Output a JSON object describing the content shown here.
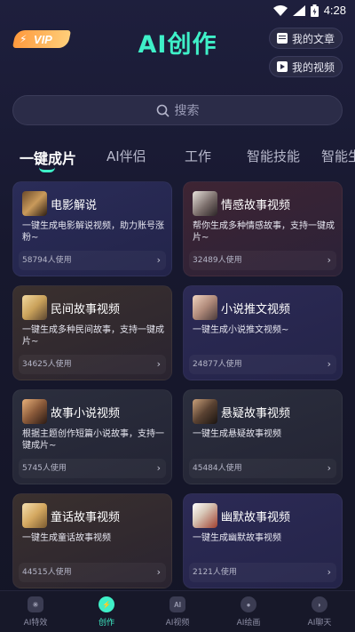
{
  "status": {
    "time": "4:28"
  },
  "header": {
    "vip_label": "VIP",
    "title": "AI创作",
    "my_articles": "我的文章",
    "my_videos": "我的视频"
  },
  "search": {
    "placeholder": "搜索"
  },
  "tabs": [
    "一键成片",
    "AI伴侣",
    "工作",
    "智能技能",
    "智能生"
  ],
  "cards": [
    {
      "title": "电影解说",
      "desc": "一键生成电影解说视频，助力账号涨粉~",
      "count": "58794人使用"
    },
    {
      "title": "情感故事视频",
      "desc": "帮你生成多种情感故事，支持一键成片~",
      "count": "32489人使用"
    },
    {
      "title": "民间故事视频",
      "desc": "一键生成多种民间故事，支持一键成片~",
      "count": "34625人使用"
    },
    {
      "title": "小说推文视频",
      "desc": "一键生成小说推文视频~",
      "count": "24877人使用"
    },
    {
      "title": "故事小说视频",
      "desc": "根据主题创作短篇小说故事，支持一键成片~",
      "count": "5745人使用"
    },
    {
      "title": "悬疑故事视频",
      "desc": "一键生成悬疑故事视频",
      "count": "45484人使用"
    },
    {
      "title": "童话故事视频",
      "desc": "一键生成童话故事视频",
      "count": "44515人使用"
    },
    {
      "title": "幽默故事视频",
      "desc": "一键生成幽默故事视频",
      "count": "2121人使用"
    }
  ],
  "nav": [
    {
      "label": "AI特效",
      "icon": "sparkle-icon"
    },
    {
      "label": "创作",
      "icon": "bolt-icon"
    },
    {
      "label": "AI视频",
      "icon": "ai-video-icon",
      "glyph": "AI"
    },
    {
      "label": "AI绘画",
      "icon": "palette-icon"
    },
    {
      "label": "AI聊天",
      "icon": "chat-icon"
    }
  ],
  "colors": {
    "accent": "#3ff0c8",
    "vip": "#ff9a3d",
    "background": "#1a1b33"
  }
}
